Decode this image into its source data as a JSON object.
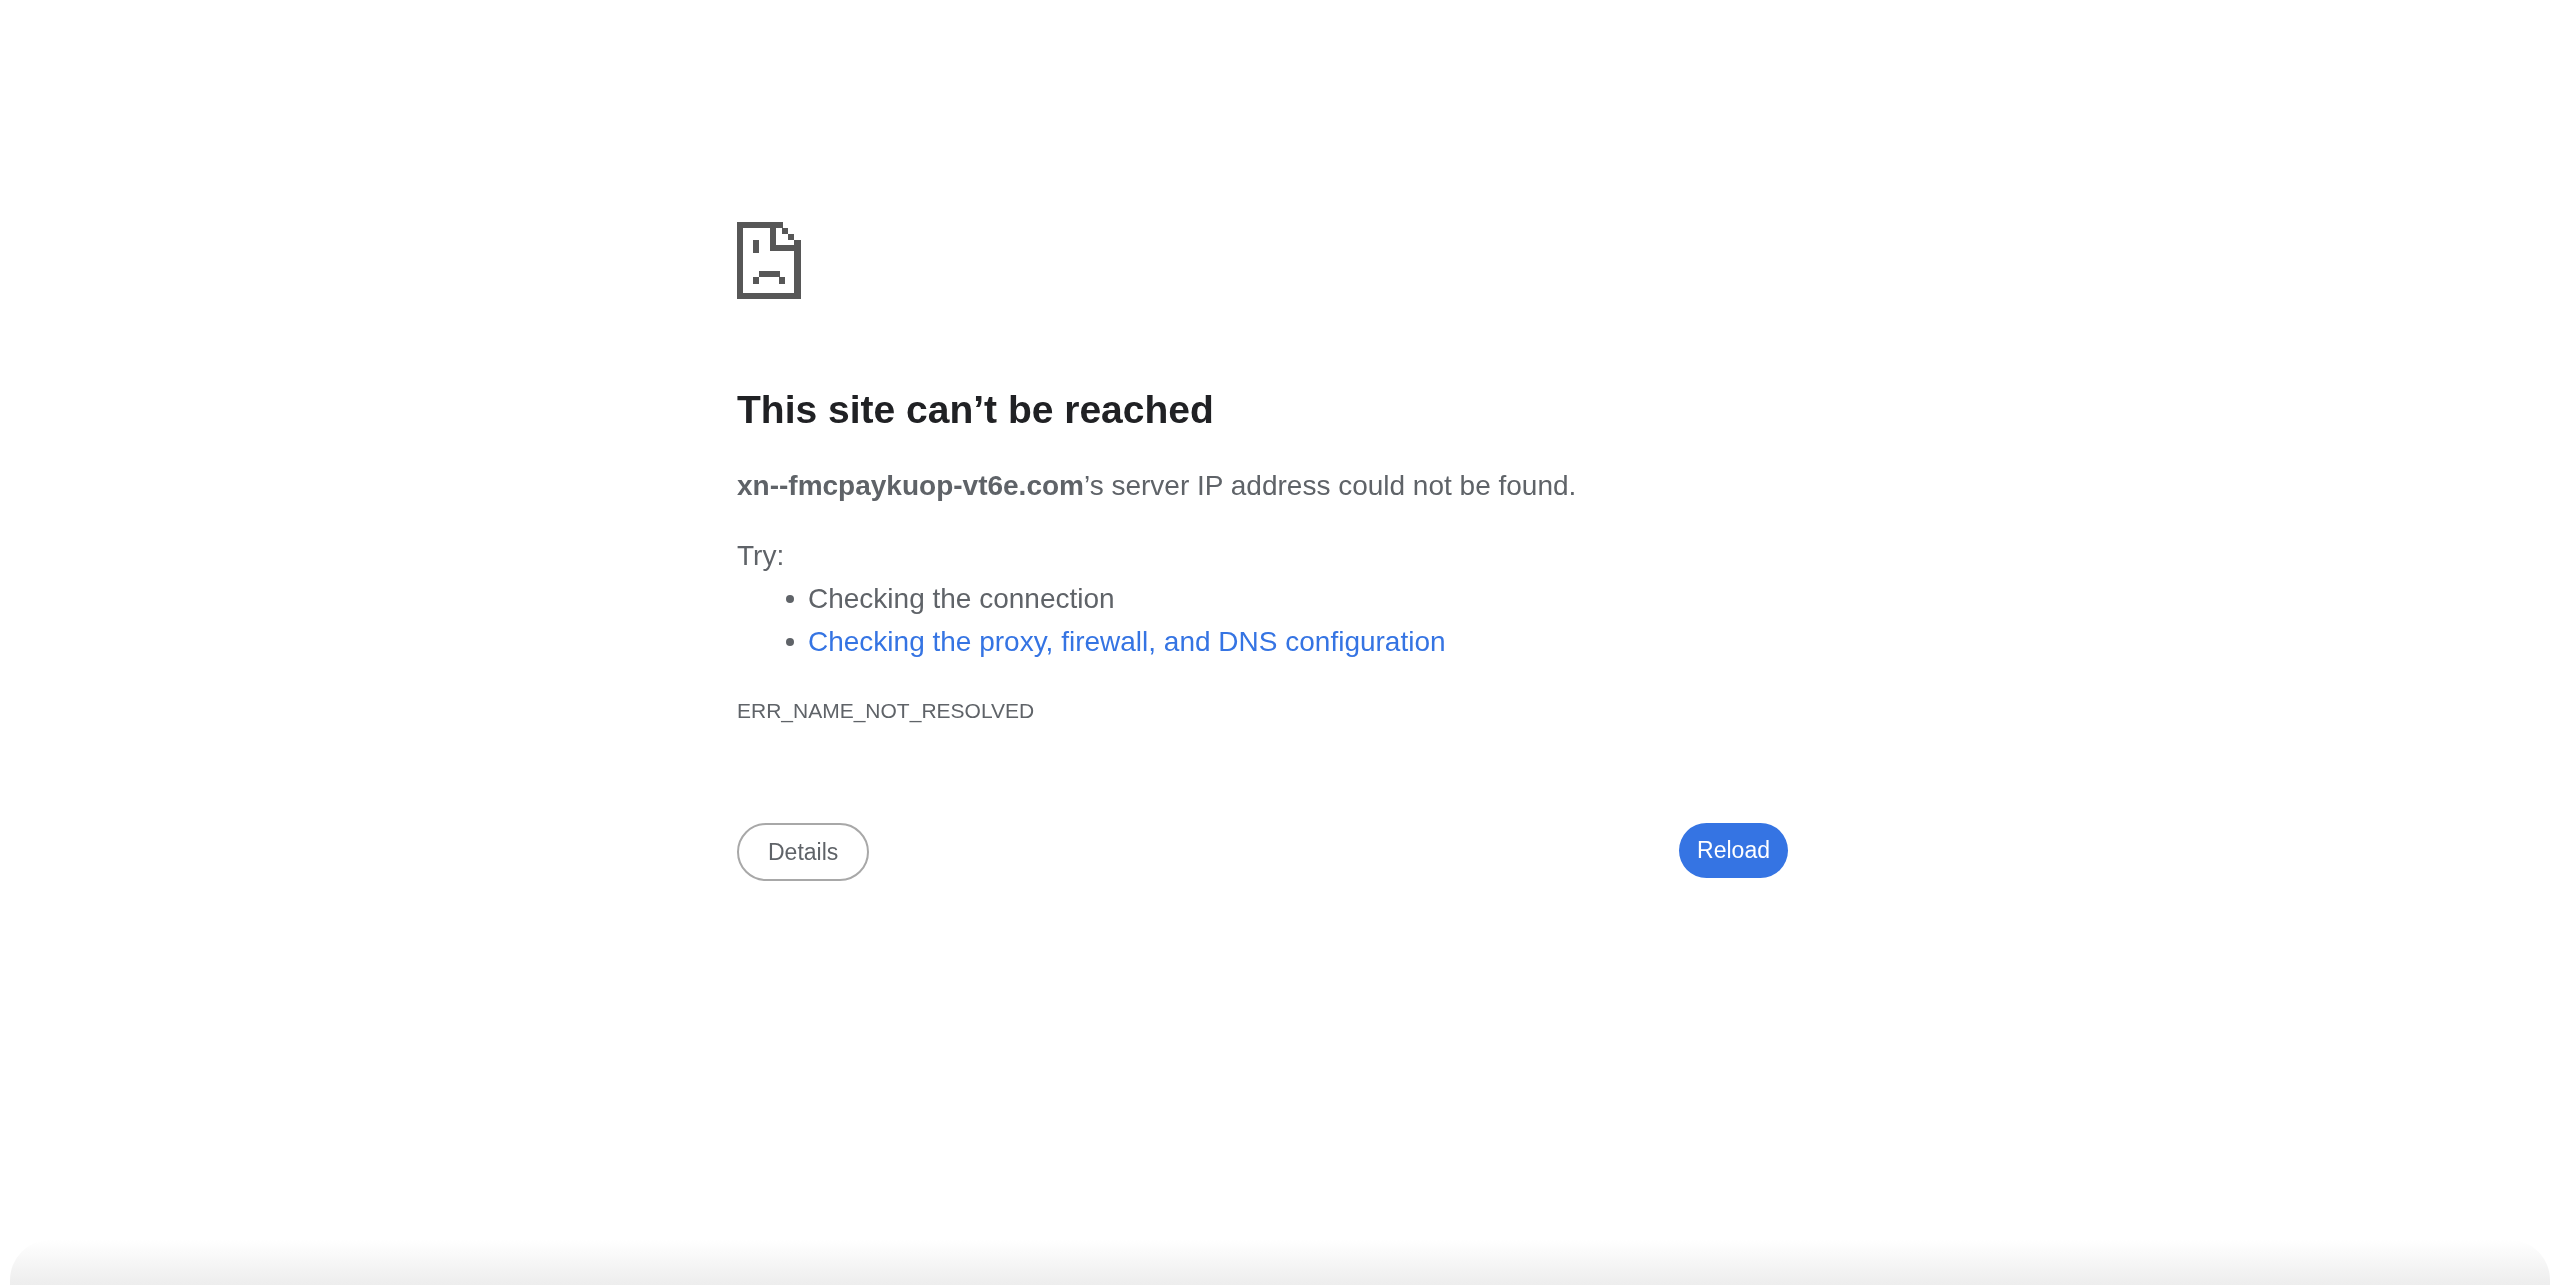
{
  "heading": "This site can’t be reached",
  "message": "**xn--fmcpaykuop-vt6e.com**’s server IP address could not be found.",
  "suggestions": {
    "label": "Try:",
    "items": [
      {
        "kind": "text",
        "text": "Checking the connection"
      },
      {
        "kind": "link",
        "text": "Checking the proxy, firewall, and DNS configuration"
      }
    ]
  },
  "error_code": "ERR_NAME_NOT_RESOLVED",
  "buttons": [
    {
      "kind": "secondary",
      "label": "Details"
    },
    {
      "kind": "primary",
      "label": "Reload"
    }
  ]
}
